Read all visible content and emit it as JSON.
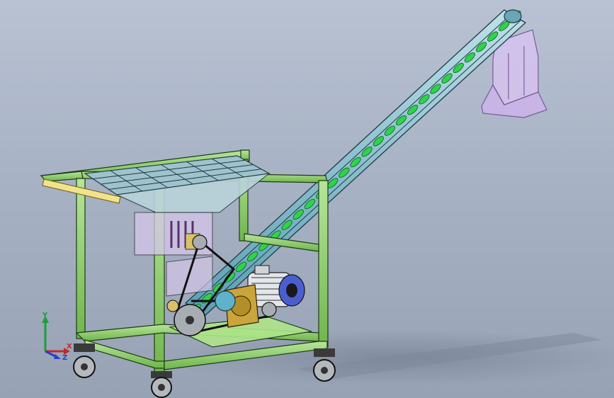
{
  "scene": {
    "colors": {
      "background_top": "#b8c2d3",
      "background_bottom": "#97a2b4",
      "frame": "#8fd06a",
      "frame_edge": "#1d3a14",
      "conveyor": "#7fb8c9",
      "flight": "#2fd34a",
      "hopper": "#c7a9e6",
      "motor": "#5a6ed8",
      "gearbox": "#c9a23a",
      "wheel": "#9aa0a6"
    }
  },
  "triad": {
    "x_label": "X",
    "y_label": "Y",
    "z_label": "Z"
  }
}
